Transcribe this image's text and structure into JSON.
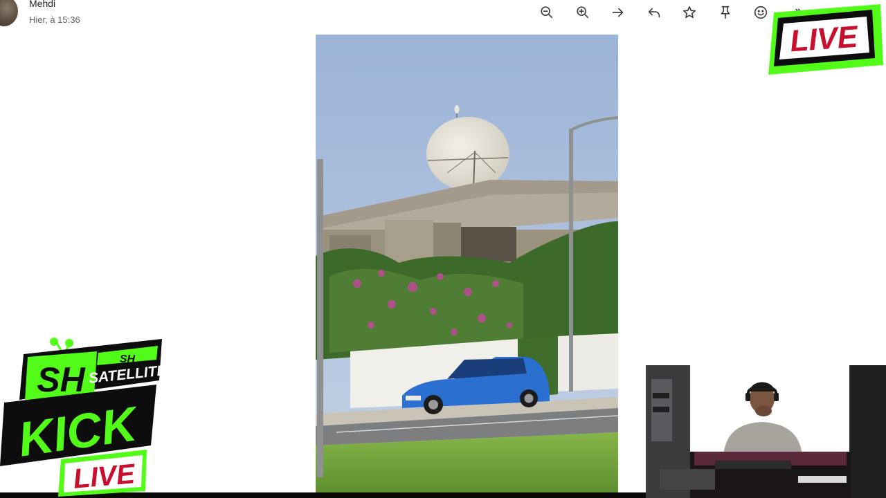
{
  "message": {
    "sender_name": "Mehdi",
    "timestamp": "Hier, à 15:36"
  },
  "toolbar": {
    "icons": [
      "zoom-out-icon",
      "zoom-in-icon",
      "forward-arrow-icon",
      "reply-icon",
      "star-icon",
      "pin-icon",
      "emoji-icon",
      "forward-all-icon"
    ]
  },
  "overlay": {
    "live_badge": "LIVE",
    "kick_logo_sh": "SH",
    "kick_logo_sh_small": "SH",
    "kick_logo_satellite": "SATELLITE",
    "kick_logo_kick": "KICK",
    "kick_logo_live": "LIVE",
    "accent_color": "#53fc18"
  }
}
